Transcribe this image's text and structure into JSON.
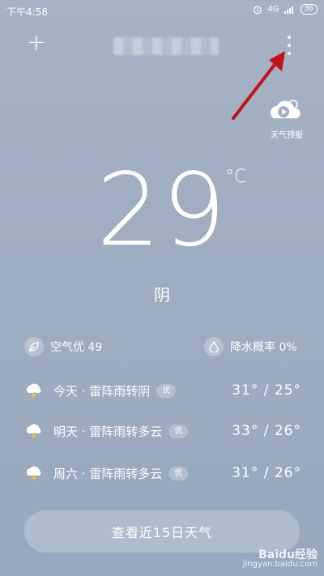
{
  "status_bar": {
    "time": "下午4:58",
    "network": "4G",
    "battery": "36"
  },
  "header": {
    "add_label": "+"
  },
  "forecast_button": {
    "label": "天气预报"
  },
  "current": {
    "temperature": "29",
    "unit": "°C",
    "condition": "阴"
  },
  "air_quality": {
    "label": "空气优 49"
  },
  "rain": {
    "label": "降水概率 0%"
  },
  "days": [
    {
      "label": "今天 · 雷阵雨转阴",
      "badge": "优",
      "range": "31° / 25°"
    },
    {
      "label": "明天 · 雷阵雨转多云",
      "badge": "优",
      "range": "33° / 26°"
    },
    {
      "label": "周六 · 雷阵雨转多云",
      "badge": "优",
      "range": "31° / 26°"
    }
  ],
  "bottom_button": {
    "label": "查看近15日天气"
  },
  "watermark": {
    "brand": "Baidu经验",
    "url": "jingyan.baidu.com"
  },
  "colors": {
    "arrow": "#c0121a",
    "background": "#9fadc0"
  }
}
